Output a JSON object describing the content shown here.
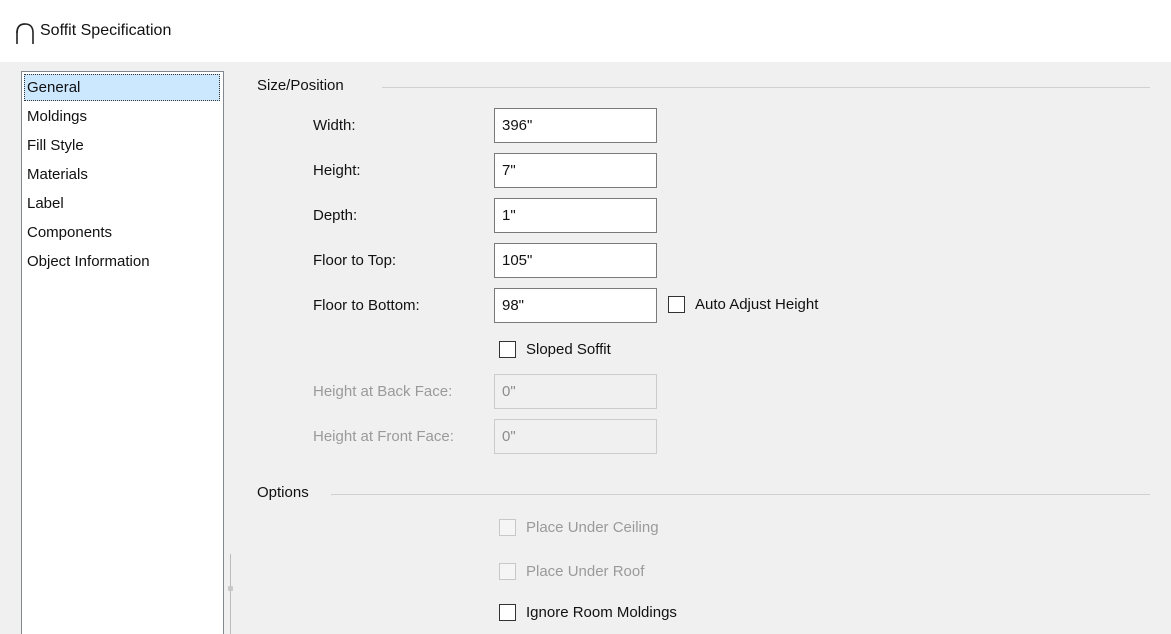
{
  "window": {
    "title": "Soffit Specification",
    "icon": "soffit-arch-icon"
  },
  "sidebar": {
    "items": [
      {
        "label": "General",
        "selected": true
      },
      {
        "label": "Moldings",
        "selected": false
      },
      {
        "label": "Fill Style",
        "selected": false
      },
      {
        "label": "Materials",
        "selected": false
      },
      {
        "label": "Label",
        "selected": false
      },
      {
        "label": "Components",
        "selected": false
      },
      {
        "label": "Object Information",
        "selected": false
      }
    ]
  },
  "size_position": {
    "header": "Size/Position",
    "width_label": "Width:",
    "width_value": "396\"",
    "height_label": "Height:",
    "height_value": "7\"",
    "depth_label": "Depth:",
    "depth_value": "1\"",
    "floor_to_top_label": "Floor to Top:",
    "floor_to_top_value": "105\"",
    "floor_to_bottom_label": "Floor to Bottom:",
    "floor_to_bottom_value": "98\"",
    "auto_adjust_height_label": "Auto Adjust Height",
    "auto_adjust_height_checked": false,
    "sloped_soffit_label": "Sloped Soffit",
    "sloped_soffit_checked": false,
    "height_back_face_label": "Height at Back Face:",
    "height_back_face_value": "0\"",
    "height_front_face_label": "Height at Front Face:",
    "height_front_face_value": "0\""
  },
  "options": {
    "header": "Options",
    "place_under_ceiling_label": "Place Under Ceiling",
    "place_under_ceiling_enabled": false,
    "place_under_roof_label": "Place Under Roof",
    "place_under_roof_enabled": false,
    "ignore_room_moldings_label": "Ignore Room Moldings",
    "ignore_room_moldings_checked": false
  },
  "colors": {
    "selection": "#cce8ff",
    "dialog_background": "#f0f0f0",
    "disabled_text": "#9a9a9a"
  }
}
